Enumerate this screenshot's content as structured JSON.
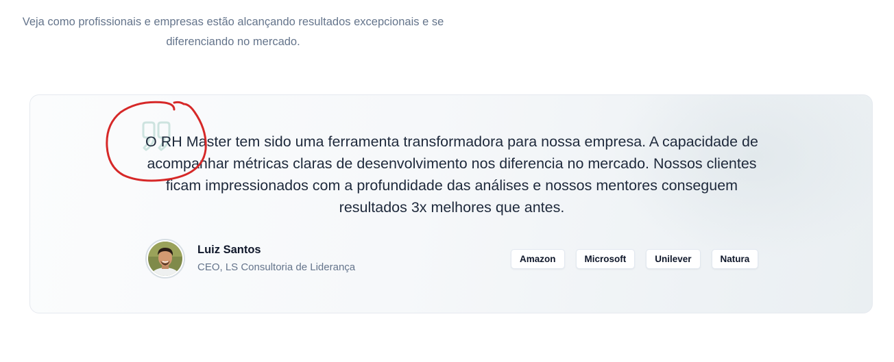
{
  "intro": {
    "text": "Veja como profissionais e empresas estão alcançando resultados excepcionais e se diferenciando no mercado."
  },
  "testimonial": {
    "quote": "O RH Master tem sido uma ferramenta transformadora para nossa empresa. A capacidade de acompanhar métricas claras de desenvolvimento nos diferencia no mercado. Nossos clientes ficam impressionados com a profundidade das análises e nossos mentores conseguem resultados 3x melhores que antes.",
    "quote_icon": "quote-icon",
    "author": {
      "name": "Luiz Santos",
      "role": "CEO, LS Consultoria de Liderança",
      "avatar_icon": "avatar"
    },
    "logos": [
      {
        "label": "Amazon"
      },
      {
        "label": "Microsoft"
      },
      {
        "label": "Unilever"
      },
      {
        "label": "Natura"
      }
    ]
  },
  "annotation": {
    "color": "#d62828",
    "shape": "hand-drawn-circle"
  }
}
